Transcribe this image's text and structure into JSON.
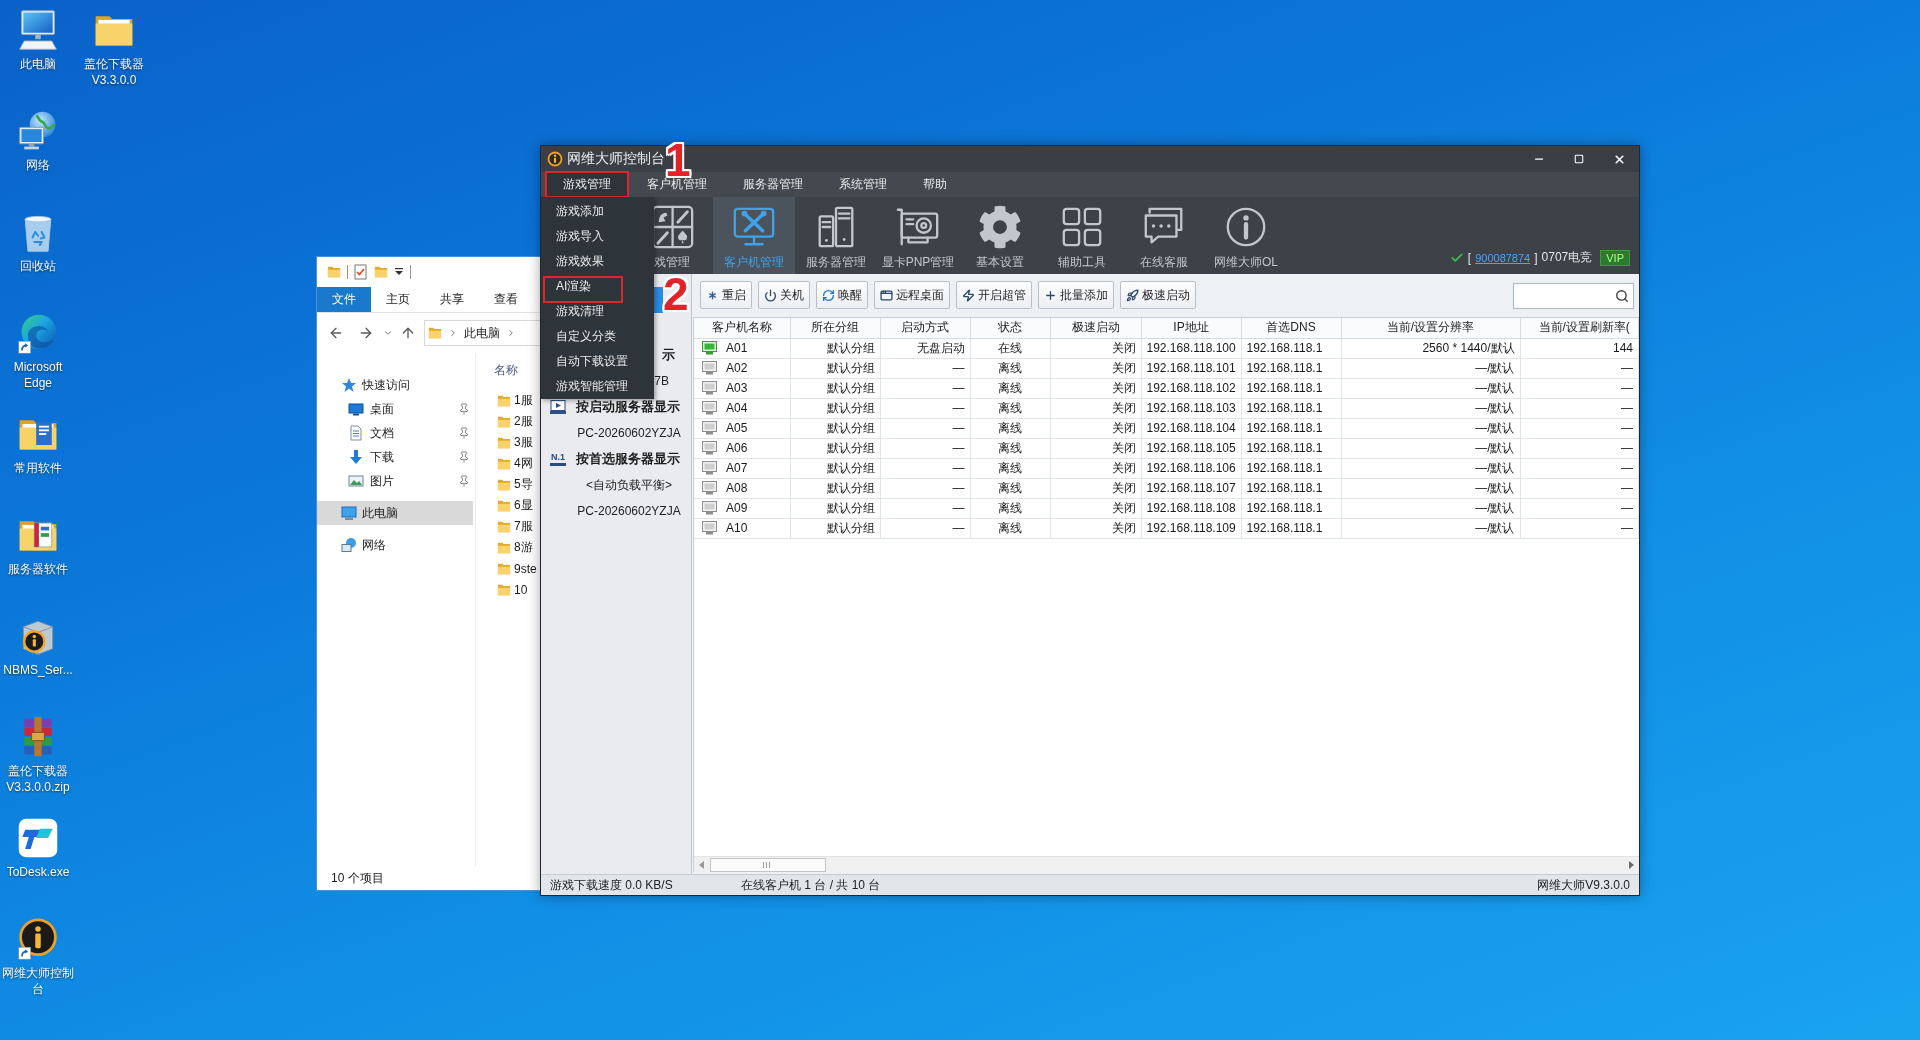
{
  "desktop": {
    "icons": [
      {
        "label": "此电脑",
        "kind": "computer",
        "shortcut": false
      },
      {
        "label": "网络",
        "kind": "network",
        "shortcut": false
      },
      {
        "label": "回收站",
        "kind": "recycle-bin",
        "shortcut": false
      },
      {
        "label": "Microsoft Edge",
        "kind": "browser",
        "shortcut": true
      },
      {
        "label": "常用软件",
        "kind": "folder-docs",
        "shortcut": false
      },
      {
        "label": "服务器软件",
        "kind": "folder-book",
        "shortcut": false
      },
      {
        "label": "NBMS_Ser...",
        "kind": "installer",
        "shortcut": false
      },
      {
        "label": "盖伦下载器 V3.3.0.0.zip",
        "kind": "archive",
        "shortcut": false
      },
      {
        "label": "ToDesk.exe",
        "kind": "remote-app",
        "shortcut": false
      },
      {
        "label": "网维大师控制台",
        "kind": "console",
        "shortcut": true
      },
      {
        "label": "盖伦下载器 V3.3.0.0",
        "kind": "folder",
        "shortcut": false
      }
    ]
  },
  "explorer": {
    "ribbon_tabs": [
      {
        "label": "文件",
        "selected": true
      },
      {
        "label": "主页",
        "selected": false
      },
      {
        "label": "共享",
        "selected": false
      },
      {
        "label": "查看",
        "selected": false
      }
    ],
    "address": [
      "此电脑"
    ],
    "nav": [
      {
        "label": "快速访问",
        "kind": "star",
        "selected": false,
        "children": [
          {
            "label": "桌面",
            "kind": "desktop",
            "pinned": true,
            "selected": false
          },
          {
            "label": "文档",
            "kind": "document",
            "pinned": true,
            "selected": false
          },
          {
            "label": "下载",
            "kind": "download",
            "pinned": true,
            "selected": false
          },
          {
            "label": "图片",
            "kind": "picture",
            "pinned": true,
            "selected": false
          }
        ]
      },
      {
        "label": "此电脑",
        "kind": "computer",
        "selected": true
      },
      {
        "label": "网络",
        "kind": "network",
        "selected": false
      }
    ],
    "list": {
      "column": "名称",
      "items": [
        "1服",
        "2服",
        "3服",
        "4网",
        "5导",
        "6显",
        "7服",
        "8游",
        "9ste",
        "10"
      ]
    },
    "status": "10 个项目"
  },
  "console": {
    "title": "网维大师控制台",
    "menu": [
      {
        "label": "游戏管理",
        "selected": true,
        "marked": true
      },
      {
        "label": "客户机管理",
        "selected": false,
        "marked": false
      },
      {
        "label": "服务器管理",
        "selected": false,
        "marked": false
      },
      {
        "label": "系统管理",
        "selected": false,
        "marked": false
      },
      {
        "label": "帮助",
        "selected": false,
        "marked": false
      }
    ],
    "dropdown": [
      {
        "label": "游戏添加",
        "marked": false
      },
      {
        "label": "游戏导入",
        "marked": false
      },
      {
        "label": "游戏效果",
        "marked": false
      },
      {
        "label": "AI渲染",
        "marked": true
      },
      {
        "label": "游戏清理",
        "marked": false
      },
      {
        "label": "自定义分类",
        "marked": false
      },
      {
        "label": "自动下载设置",
        "marked": false
      },
      {
        "label": "游戏智能管理",
        "marked": false
      }
    ],
    "toolbar": [
      {
        "label": "戏管理",
        "kind": "games",
        "selected": false
      },
      {
        "label": "客户机管理",
        "kind": "clients",
        "selected": true
      },
      {
        "label": "服务器管理",
        "kind": "servers",
        "selected": false
      },
      {
        "label": "显卡PNP管理",
        "kind": "gpu",
        "selected": false
      },
      {
        "label": "基本设置",
        "kind": "settings",
        "selected": false
      },
      {
        "label": "辅助工具",
        "kind": "tools",
        "selected": false
      },
      {
        "label": "在线客服",
        "kind": "support",
        "selected": false
      },
      {
        "label": "网维大师OL",
        "kind": "about",
        "selected": false
      }
    ],
    "account": {
      "open": "[",
      "id": "900087874",
      "close": "]",
      "name": "0707电竞",
      "badge": "VIP"
    },
    "actions": [
      {
        "label": "重启",
        "kind": "restart"
      },
      {
        "label": "关机",
        "kind": "shutdown"
      },
      {
        "label": "唤醒",
        "kind": "wake"
      },
      {
        "label": "远程桌面",
        "kind": "remote"
      },
      {
        "label": "开启超管",
        "kind": "admin"
      },
      {
        "label": "批量添加",
        "kind": "add"
      },
      {
        "label": "极速启动",
        "kind": "boost"
      }
    ],
    "tree": [
      {
        "label": "示",
        "kind": "covered",
        "children": [
          {
            "label": "7B"
          }
        ]
      },
      {
        "label": "按启动服务器显示",
        "kind": "boot",
        "children": [
          {
            "label": "PC-20260602YZJA"
          }
        ]
      },
      {
        "label": "按首选服务器显示",
        "kind": "rank",
        "badge": "N.1",
        "children": [
          {
            "label": "<自动负载平衡>"
          },
          {
            "label": "PC-20260602YZJA"
          }
        ]
      }
    ],
    "table": {
      "columns": [
        "客户机名称",
        "所在分组",
        "启动方式",
        "状态",
        "极速启动",
        "IP地址",
        "首选DNS",
        "当前/设置分辨率",
        "当前/设置刷新率("
      ],
      "rows": [
        {
          "online": true,
          "cells": [
            "A01",
            "默认分组",
            "无盘启动",
            "在线",
            "关闭",
            "192.168.118.100",
            "192.168.118.1",
            "2560 * 1440/默认",
            "144"
          ]
        },
        {
          "online": false,
          "cells": [
            "A02",
            "默认分组",
            "—",
            "离线",
            "关闭",
            "192.168.118.101",
            "192.168.118.1",
            "—/默认",
            "—"
          ]
        },
        {
          "online": false,
          "cells": [
            "A03",
            "默认分组",
            "—",
            "离线",
            "关闭",
            "192.168.118.102",
            "192.168.118.1",
            "—/默认",
            "—"
          ]
        },
        {
          "online": false,
          "cells": [
            "A04",
            "默认分组",
            "—",
            "离线",
            "关闭",
            "192.168.118.103",
            "192.168.118.1",
            "—/默认",
            "—"
          ]
        },
        {
          "online": false,
          "cells": [
            "A05",
            "默认分组",
            "—",
            "离线",
            "关闭",
            "192.168.118.104",
            "192.168.118.1",
            "—/默认",
            "—"
          ]
        },
        {
          "online": false,
          "cells": [
            "A06",
            "默认分组",
            "—",
            "离线",
            "关闭",
            "192.168.118.105",
            "192.168.118.1",
            "—/默认",
            "—"
          ]
        },
        {
          "online": false,
          "cells": [
            "A07",
            "默认分组",
            "—",
            "离线",
            "关闭",
            "192.168.118.106",
            "192.168.118.1",
            "—/默认",
            "—"
          ]
        },
        {
          "online": false,
          "cells": [
            "A08",
            "默认分组",
            "—",
            "离线",
            "关闭",
            "192.168.118.107",
            "192.168.118.1",
            "—/默认",
            "—"
          ]
        },
        {
          "online": false,
          "cells": [
            "A09",
            "默认分组",
            "—",
            "离线",
            "关闭",
            "192.168.118.108",
            "192.168.118.1",
            "—/默认",
            "—"
          ]
        },
        {
          "online": false,
          "cells": [
            "A10",
            "默认分组",
            "—",
            "离线",
            "关闭",
            "192.168.118.109",
            "192.168.118.1",
            "—/默认",
            "—"
          ]
        }
      ]
    },
    "status_bar": [
      "游戏下载速度 0.0 KB/S",
      "在线客户机 1 台 / 共 10 台",
      "网维大师V9.3.0.0"
    ]
  },
  "annotations": [
    {
      "label": "1"
    },
    {
      "label": "2"
    }
  ]
}
